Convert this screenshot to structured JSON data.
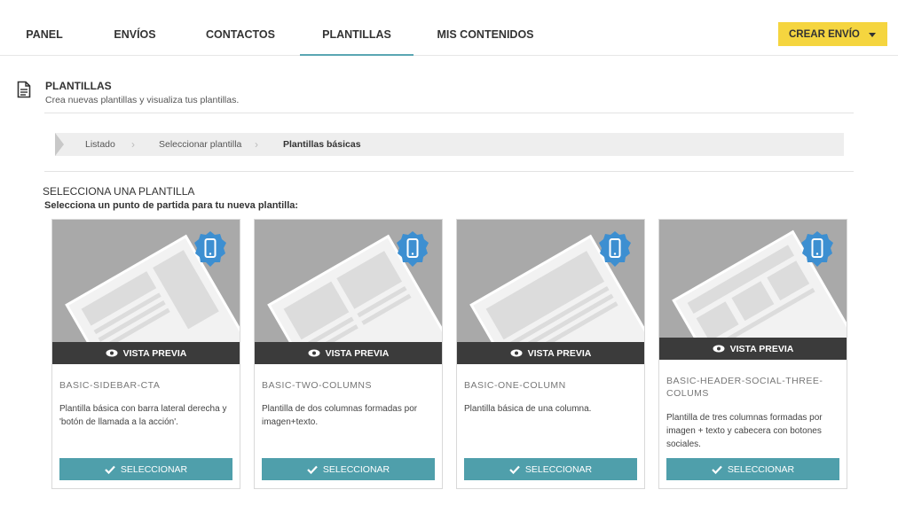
{
  "nav": {
    "tabs": [
      {
        "label": "PANEL"
      },
      {
        "label": "ENVÍOS"
      },
      {
        "label": "CONTACTOS"
      },
      {
        "label": "PLANTILLAS"
      },
      {
        "label": "MIS CONTENIDOS"
      }
    ],
    "active_tab": "PLANTILLAS",
    "create_button": "CREAR ENVÍO"
  },
  "header": {
    "icon": "document-icon",
    "title": "PLANTILLAS",
    "subtitle": "Crea nuevas plantillas y visualiza tus plantillas."
  },
  "breadcrumb": {
    "items": [
      "Listado",
      "Seleccionar plantilla",
      "Plantillas básicas"
    ]
  },
  "section": {
    "title": "SELECCIONA UNA PLANTILLA",
    "subtitle": "Selecciona un punto de partida para tu nueva plantilla:"
  },
  "templates": [
    {
      "name": "BASIC-SIDEBAR-CTA",
      "description": "Plantilla básica con barra lateral derecha y 'botón de llamada a la acción'.",
      "preview_label": "VISTA PREVIA",
      "select_label": "SELECCIONAR",
      "badge_icon": "mobile-icon"
    },
    {
      "name": "BASIC-TWO-COLUMNS",
      "description": "Plantilla de dos columnas formadas por imagen+texto.",
      "preview_label": "VISTA PREVIA",
      "select_label": "SELECCIONAR",
      "badge_icon": "mobile-icon"
    },
    {
      "name": "BASIC-ONE-COLUMN",
      "description": "Plantilla básica de una columna.",
      "preview_label": "VISTA PREVIA",
      "select_label": "SELECCIONAR",
      "badge_icon": "mobile-icon"
    },
    {
      "name": "BASIC-HEADER-SOCIAL-THREE-COLUMS",
      "description": "Plantilla de tres columnas formadas por imagen + texto y cabecera con botones sociales.",
      "preview_label": "VISTA PREVIA",
      "select_label": "SELECCIONAR",
      "badge_icon": "mobile-icon"
    }
  ],
  "colors": {
    "accent": "#4f9fab",
    "create_button": "#f5d53f",
    "badge": "#3d8fd1",
    "thumbnail_bg": "#a9a9a9",
    "preview_bar": "#3b3b3b"
  }
}
